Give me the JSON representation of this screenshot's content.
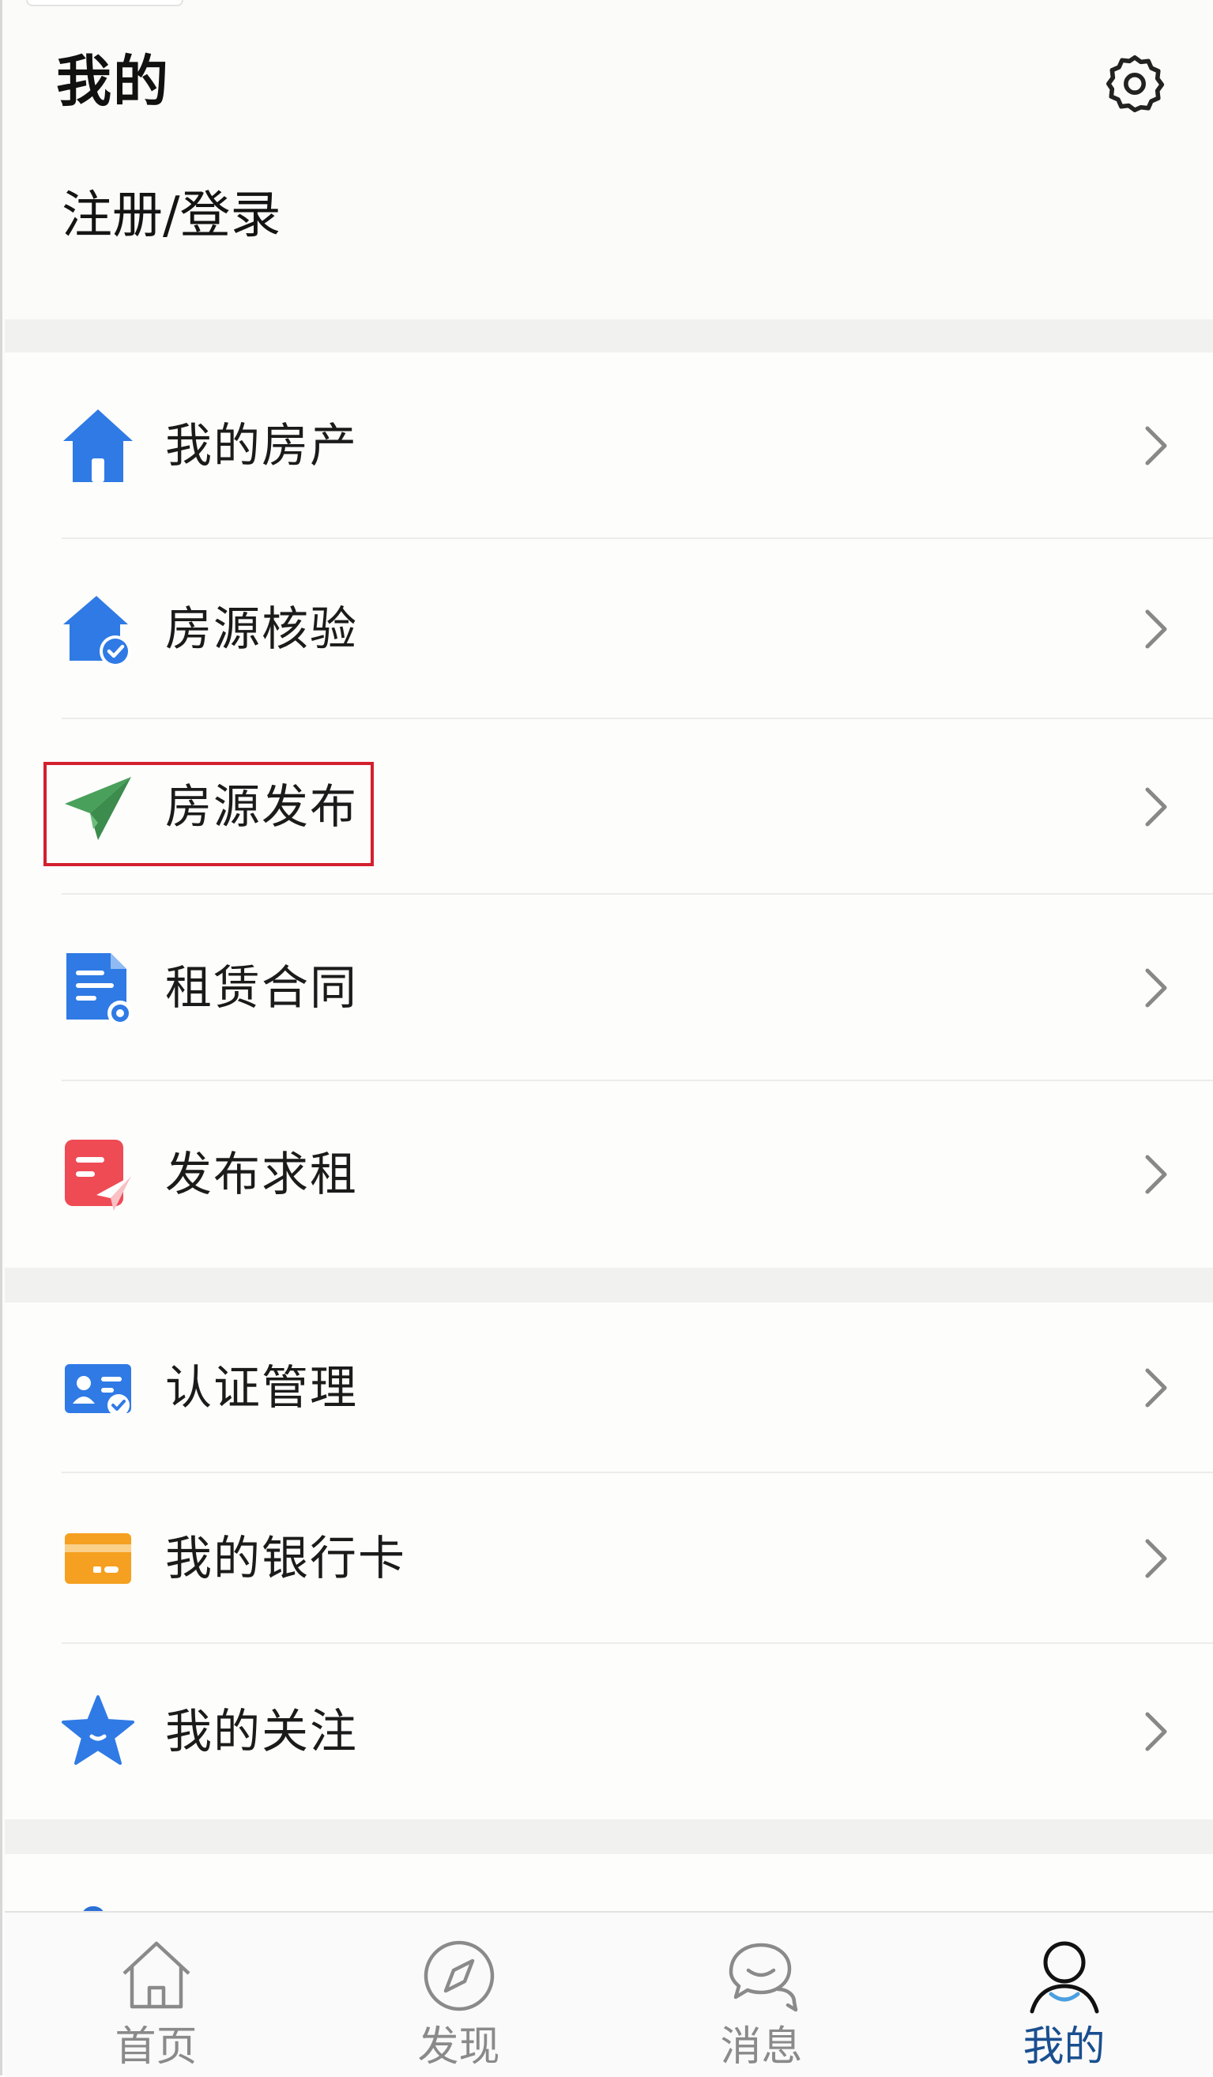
{
  "header": {
    "title": "我的"
  },
  "login": {
    "label": "注册/登录"
  },
  "menu_group_1": [
    {
      "label": "我的房产",
      "icon": "house-icon",
      "color": "#2f7ae5"
    },
    {
      "label": "房源核验",
      "icon": "house-check-icon",
      "color": "#2f7ae5"
    },
    {
      "label": "房源发布",
      "icon": "paper-plane-icon",
      "color": "#49a05b"
    },
    {
      "label": "租赁合同",
      "icon": "contract-document-icon",
      "color": "#2f7ae5"
    },
    {
      "label": "发布求租",
      "icon": "rental-request-icon",
      "color": "#ee4b55"
    }
  ],
  "menu_group_2": [
    {
      "label": "认证管理",
      "icon": "id-card-icon",
      "color": "#2f7ae5"
    },
    {
      "label": "我的银行卡",
      "icon": "bank-card-icon",
      "color": "#f5a020"
    },
    {
      "label": "我的关注",
      "icon": "star-icon",
      "color": "#2f7ae5"
    }
  ],
  "tabs": [
    {
      "label": "首页",
      "icon": "home-icon",
      "active": false
    },
    {
      "label": "发现",
      "icon": "compass-icon",
      "active": false
    },
    {
      "label": "消息",
      "icon": "chat-icon",
      "active": false
    },
    {
      "label": "我的",
      "icon": "user-icon",
      "active": true
    }
  ],
  "colors": {
    "accent": "#2f7ae5",
    "active_tab": "#1a4f8f",
    "highlight_box": "#d3202e"
  }
}
